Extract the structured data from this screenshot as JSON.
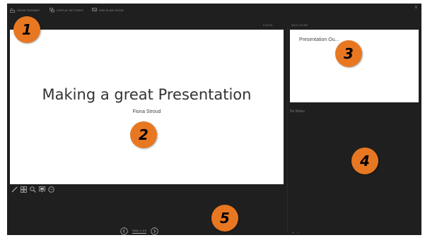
{
  "toolbar": {
    "items": [
      {
        "label": "SHOW TASKBAR",
        "icon": "taskbar-icon"
      },
      {
        "label": "DISPLAY SETTINGS",
        "icon": "display-settings-icon"
      },
      {
        "label": "END SLIDE SHOW",
        "icon": "end-show-icon"
      }
    ],
    "close_glyph": "≡"
  },
  "presenter": {
    "elapsed_label": "0:00:09",
    "next_slide_label": "NEXT SLIDE",
    "notes_label": "No Notes"
  },
  "current_slide": {
    "title": "Making a great Presentation",
    "subtitle": "Fiona Stroud"
  },
  "next_slide": {
    "title": "Presentation Ou..."
  },
  "tools": [
    "pen-tool-icon",
    "view-all-slides-icon",
    "zoom-icon",
    "black-screen-icon",
    "more-options-icon"
  ],
  "navigation": {
    "counter": "Slide 1 of 5"
  },
  "zoom_controls": {
    "zoom_in": "+",
    "zoom_out": "-"
  },
  "callouts": [
    {
      "number": "1",
      "color": "#e87722"
    },
    {
      "number": "2",
      "color": "#e87722"
    },
    {
      "number": "3",
      "color": "#e87722"
    },
    {
      "number": "4",
      "color": "#e87722"
    },
    {
      "number": "5",
      "color": "#e87722"
    }
  ]
}
